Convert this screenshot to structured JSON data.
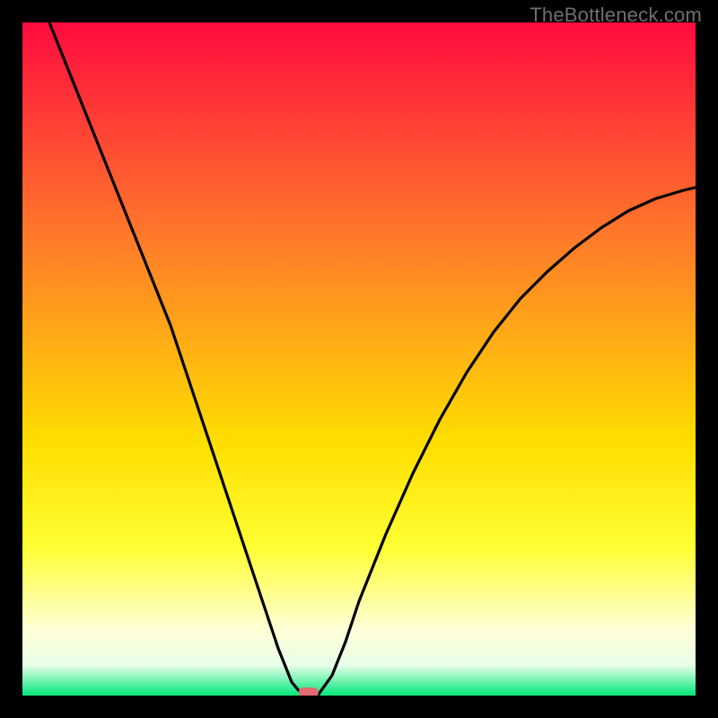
{
  "watermark": "TheBottleneck.com",
  "colors": {
    "bg_black": "#000000",
    "grad_top": "#ff0b3e",
    "grad_mid": "#ffee00",
    "grad_bottom": "#00e77a",
    "curve": "#000000",
    "marker": "#e06a6e",
    "watermark": "#6f6f6f"
  },
  "chart_data": {
    "type": "line",
    "title": "",
    "xlabel": "",
    "ylabel": "",
    "xlim": [
      0,
      100
    ],
    "ylim": [
      0,
      100
    ],
    "notch_x": 42,
    "marker": {
      "x": 42.5,
      "y": 0,
      "color": "#e06a6e"
    },
    "series": [
      {
        "name": "curve",
        "x": [
          4,
          6,
          8,
          10,
          12,
          14,
          16,
          18,
          20,
          22,
          24,
          26,
          28,
          30,
          32,
          34,
          36,
          38,
          40,
          41,
          42,
          43,
          44,
          46,
          48,
          50,
          54,
          58,
          62,
          66,
          70,
          74,
          78,
          82,
          86,
          90,
          94,
          98,
          100
        ],
        "y": [
          100,
          95,
          90,
          85,
          80,
          75,
          70,
          65,
          60,
          55,
          49,
          43,
          37,
          31,
          25,
          19,
          13,
          7,
          2,
          0.8,
          0,
          0,
          0.2,
          3,
          8,
          14,
          24,
          33,
          41,
          48,
          54,
          59,
          63,
          66.5,
          69.5,
          72,
          73.8,
          75,
          75.5
        ]
      }
    ],
    "background_gradient": {
      "type": "vertical",
      "stops": [
        {
          "offset": 0.0,
          "color": "#ff0b3e"
        },
        {
          "offset": 0.32,
          "color": "#ff7a2a"
        },
        {
          "offset": 0.62,
          "color": "#ffdd00"
        },
        {
          "offset": 0.78,
          "color": "#ffff33"
        },
        {
          "offset": 0.9,
          "color": "#ffffd6"
        },
        {
          "offset": 0.955,
          "color": "#e8ffe8"
        },
        {
          "offset": 1.0,
          "color": "#00e77a"
        }
      ]
    }
  }
}
